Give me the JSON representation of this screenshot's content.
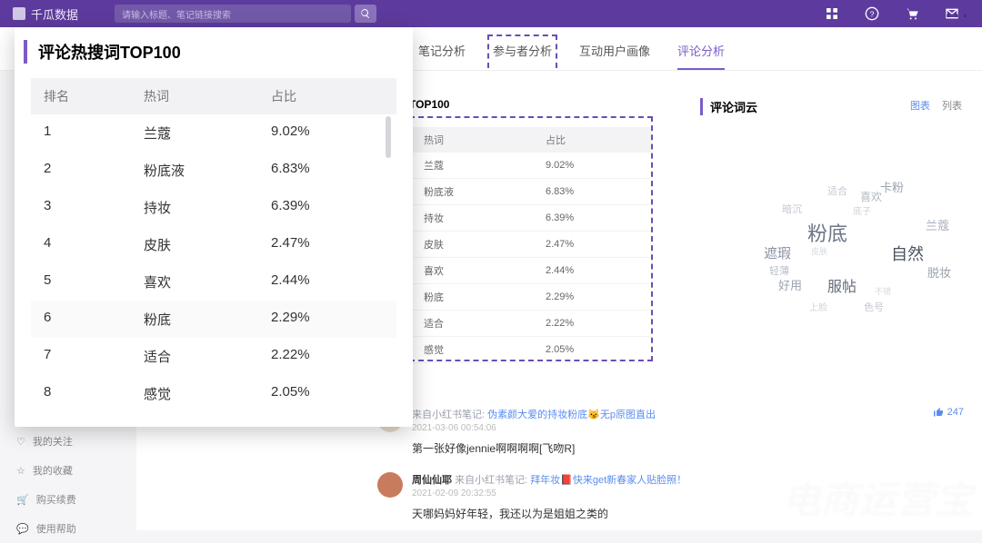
{
  "topbar": {
    "brand": "千瓜数据",
    "search_placeholder": "请输入标题、笔记链接搜索",
    "ellipsis": "⋯"
  },
  "tabs": {
    "items": [
      "笔记分析",
      "参与者分析",
      "互动用户画像",
      "评论分析"
    ],
    "callout_idx": 1,
    "active_idx": 3
  },
  "popup": {
    "title": "评论热搜词TOP100",
    "headers": [
      "排名",
      "热词",
      "占比"
    ],
    "rows": [
      [
        "1",
        "兰蔻",
        "9.02%"
      ],
      [
        "2",
        "粉底液",
        "6.83%"
      ],
      [
        "3",
        "持妆",
        "6.39%"
      ],
      [
        "4",
        "皮肤",
        "2.47%"
      ],
      [
        "5",
        "喜欢",
        "2.44%"
      ],
      [
        "6",
        "粉底",
        "2.29%"
      ],
      [
        "7",
        "适合",
        "2.22%"
      ],
      [
        "8",
        "感觉",
        "2.05%"
      ]
    ]
  },
  "mini": {
    "title": "TOP100",
    "headers": [
      "热词",
      "占比"
    ],
    "rows": [
      [
        "兰蔻",
        "9.02%"
      ],
      [
        "粉底液",
        "6.83%"
      ],
      [
        "持妆",
        "6.39%"
      ],
      [
        "皮肤",
        "2.47%"
      ],
      [
        "喜欢",
        "2.44%"
      ],
      [
        "粉底",
        "2.29%"
      ],
      [
        "适合",
        "2.22%"
      ],
      [
        "感觉",
        "2.05%"
      ]
    ]
  },
  "wordcloud": {
    "title": "评论词云",
    "toggle_chart": "图表",
    "toggle_list": "列表",
    "words": [
      "粉底",
      "自然",
      "遮瑕",
      "兰蔻",
      "服帖",
      "好用",
      "脱妆",
      "轻薄",
      "喜欢",
      "适合",
      "卡粉",
      "暗沉",
      "底子",
      "色号",
      "上脸",
      "不错",
      "皮肤"
    ]
  },
  "comments": [
    {
      "meta_prefix": "来自小红书笔记:",
      "title": "伪素颜大爱的持妆粉底😼无p原图直出",
      "date": "2021-03-06 00:54:06",
      "text": "第一张好像jennie啊啊啊啊[飞吻R]",
      "like": "247",
      "avatar": "#e8dcc8"
    },
    {
      "name": "周仙仙耶",
      "meta_prefix": "来自小红书笔记:",
      "title": "拜年妆📕快来get新春家人贴脸照！",
      "date": "2021-02-09 20:32:55",
      "text": "天哪妈妈好年轻，我还以为是姐姐之类的",
      "avatar": "#c97b5e"
    }
  ],
  "sidebar": {
    "items": [
      {
        "icon": "heart",
        "label": "我的关注"
      },
      {
        "icon": "star",
        "label": "我的收藏"
      },
      {
        "icon": "cart",
        "label": "购买续费"
      },
      {
        "icon": "chat",
        "label": "使用帮助"
      }
    ]
  },
  "watermark": "电商运营宝"
}
